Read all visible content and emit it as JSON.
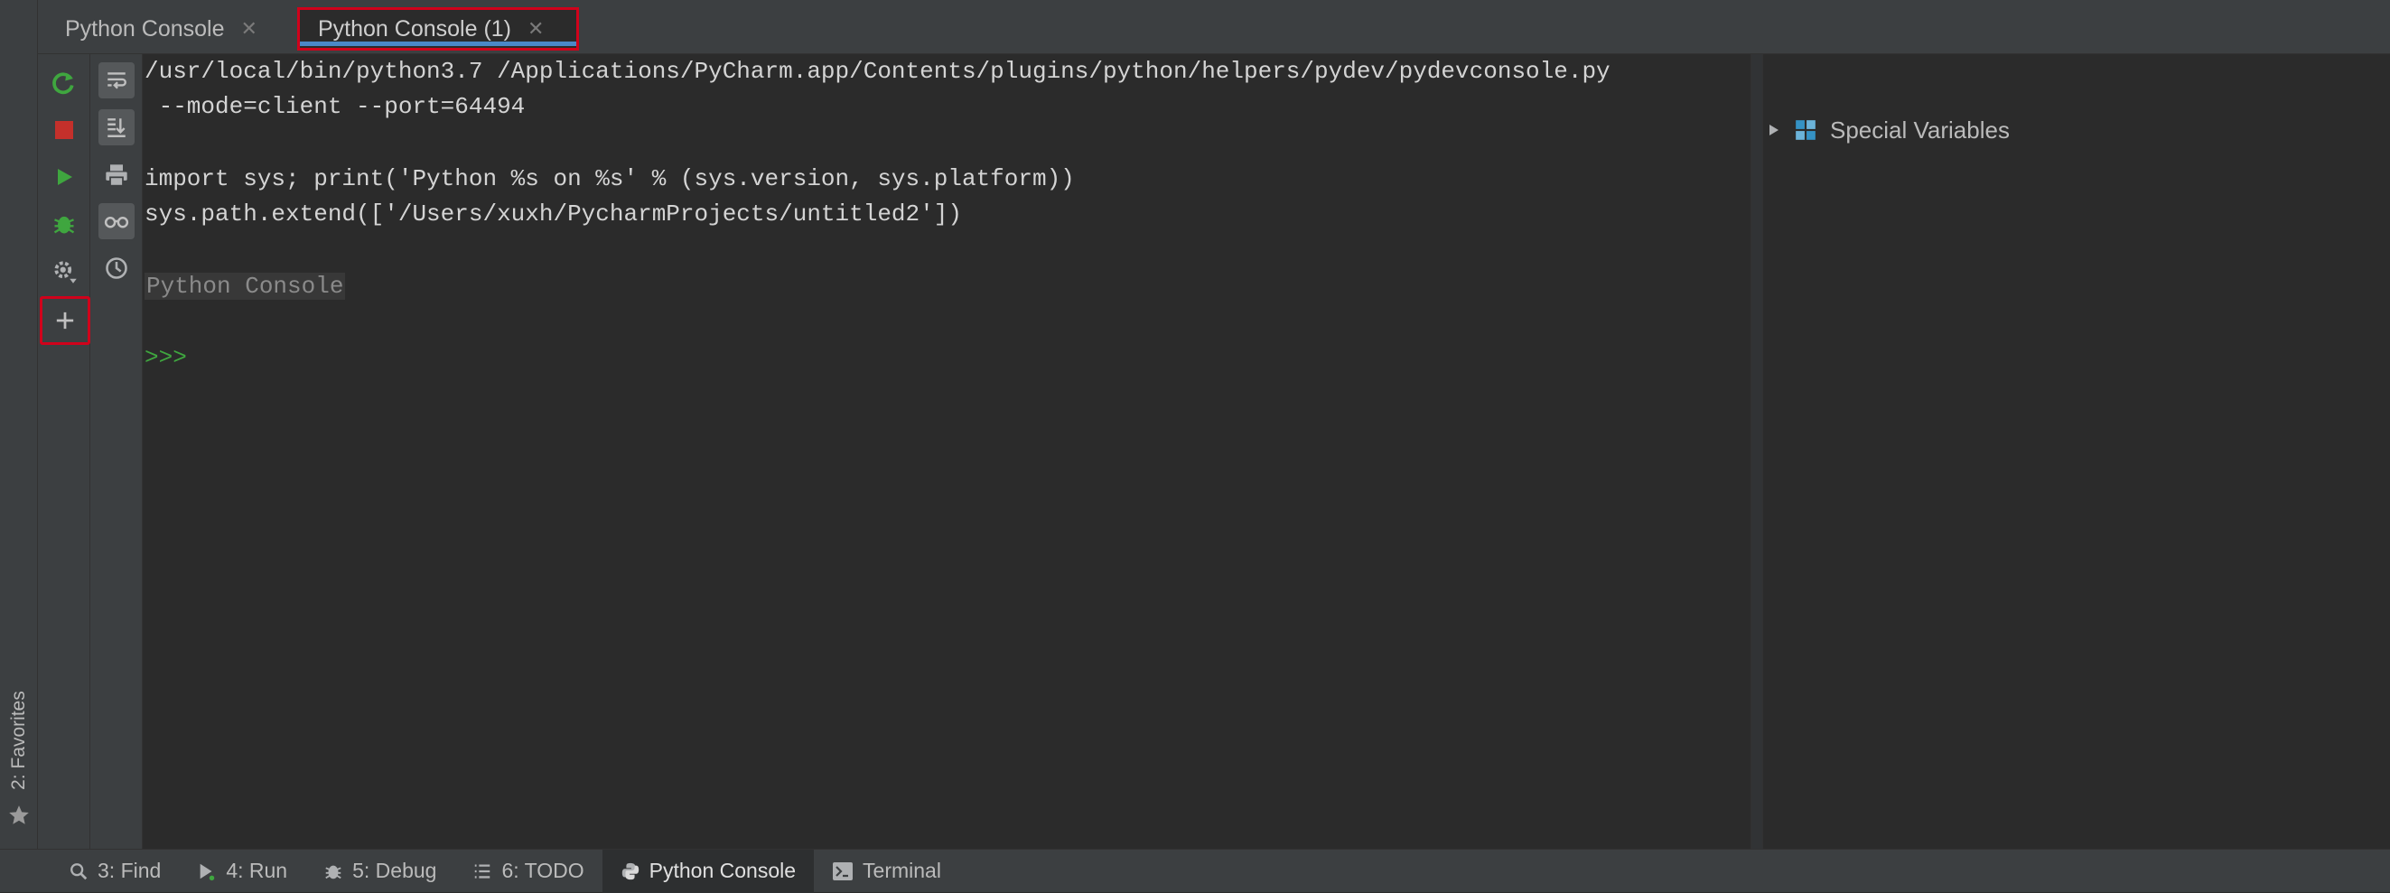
{
  "favorites": {
    "label": "2: Favorites",
    "icon": "star-icon"
  },
  "tabs": [
    {
      "label": "Python Console",
      "active": false
    },
    {
      "label": "Python Console (1)",
      "active": true
    }
  ],
  "console": {
    "lines": [
      "/usr/local/bin/python3.7 /Applications/PyCharm.app/Contents/plugins/python/helpers/pydev/pydevconsole.py",
      " --mode=client --port=64494",
      "import sys; print('Python %s on %s' % (sys.version, sys.platform))",
      "sys.path.extend(['/Users/xuxh/PycharmProjects/untitled2'])"
    ],
    "banner": "Python Console",
    "prompt": ">>>"
  },
  "variables": {
    "root_label": "Special Variables"
  },
  "bottom_bar": [
    {
      "label": "3: Find",
      "icon": "search-icon"
    },
    {
      "label": "4: Run",
      "icon": "run-icon"
    },
    {
      "label": "5: Debug",
      "icon": "bug-icon"
    },
    {
      "label": "6: TODO",
      "icon": "list-icon"
    },
    {
      "label": "Python Console",
      "icon": "python-icon",
      "active": true
    },
    {
      "label": "Terminal",
      "icon": "terminal-icon"
    }
  ],
  "colors": {
    "highlight_border": "#d0021b",
    "tab_underline": "#4a88c7",
    "run_green": "#3fa63f",
    "stop_red": "#c4302b"
  }
}
